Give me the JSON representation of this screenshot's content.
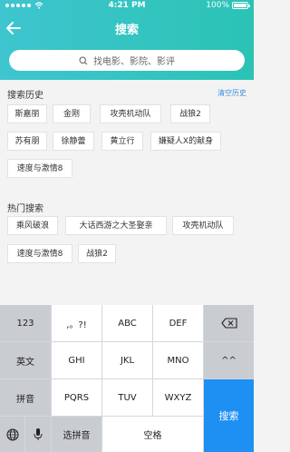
{
  "statusbar": {
    "time": "4:21 PM",
    "battery": "100%"
  },
  "nav": {
    "title": "搜索"
  },
  "search": {
    "placeholder": "找电影、影院、影评"
  },
  "history": {
    "title": "搜索历史",
    "clear_label": "清空历史",
    "tags": [
      "斯嘉丽",
      "金刚",
      "攻壳机动队",
      "战狼2",
      "苏有朋",
      "徐静蕾",
      "黄立行",
      "嫌疑人X的献身",
      "速度与激情8"
    ]
  },
  "hot": {
    "title": "热门搜索",
    "tags": [
      "乘风破浪",
      "大话西游之大圣娶亲",
      "攻壳机动队",
      "速度与激情8",
      "战狼2"
    ]
  },
  "keyboard": {
    "row1": [
      "123",
      ",。?!",
      "ABC",
      "DEF"
    ],
    "row2": [
      "英文",
      "GHI",
      "JKL",
      "MNO",
      "^^"
    ],
    "row3": [
      "拼音",
      "PQRS",
      "TUV",
      "WXYZ",
      "搜索"
    ],
    "row4": [
      "选拼音",
      "空格"
    ]
  },
  "colors": {
    "accent": "#2bc3b5",
    "link": "#3b8fd8",
    "search_key": "#1e90f3"
  }
}
